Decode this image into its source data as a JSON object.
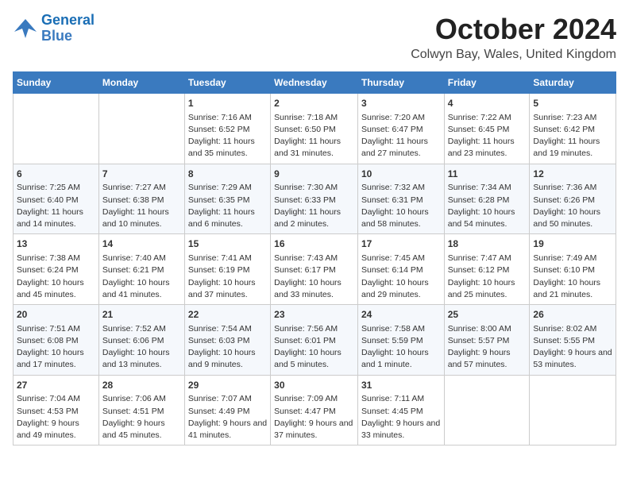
{
  "logo": {
    "line1": "General",
    "line2": "Blue"
  },
  "title": "October 2024",
  "subtitle": "Colwyn Bay, Wales, United Kingdom",
  "days_of_week": [
    "Sunday",
    "Monday",
    "Tuesday",
    "Wednesday",
    "Thursday",
    "Friday",
    "Saturday"
  ],
  "weeks": [
    [
      {
        "day": "",
        "info": ""
      },
      {
        "day": "",
        "info": ""
      },
      {
        "day": "1",
        "info": "Sunrise: 7:16 AM\nSunset: 6:52 PM\nDaylight: 11 hours and 35 minutes."
      },
      {
        "day": "2",
        "info": "Sunrise: 7:18 AM\nSunset: 6:50 PM\nDaylight: 11 hours and 31 minutes."
      },
      {
        "day": "3",
        "info": "Sunrise: 7:20 AM\nSunset: 6:47 PM\nDaylight: 11 hours and 27 minutes."
      },
      {
        "day": "4",
        "info": "Sunrise: 7:22 AM\nSunset: 6:45 PM\nDaylight: 11 hours and 23 minutes."
      },
      {
        "day": "5",
        "info": "Sunrise: 7:23 AM\nSunset: 6:42 PM\nDaylight: 11 hours and 19 minutes."
      }
    ],
    [
      {
        "day": "6",
        "info": "Sunrise: 7:25 AM\nSunset: 6:40 PM\nDaylight: 11 hours and 14 minutes."
      },
      {
        "day": "7",
        "info": "Sunrise: 7:27 AM\nSunset: 6:38 PM\nDaylight: 11 hours and 10 minutes."
      },
      {
        "day": "8",
        "info": "Sunrise: 7:29 AM\nSunset: 6:35 PM\nDaylight: 11 hours and 6 minutes."
      },
      {
        "day": "9",
        "info": "Sunrise: 7:30 AM\nSunset: 6:33 PM\nDaylight: 11 hours and 2 minutes."
      },
      {
        "day": "10",
        "info": "Sunrise: 7:32 AM\nSunset: 6:31 PM\nDaylight: 10 hours and 58 minutes."
      },
      {
        "day": "11",
        "info": "Sunrise: 7:34 AM\nSunset: 6:28 PM\nDaylight: 10 hours and 54 minutes."
      },
      {
        "day": "12",
        "info": "Sunrise: 7:36 AM\nSunset: 6:26 PM\nDaylight: 10 hours and 50 minutes."
      }
    ],
    [
      {
        "day": "13",
        "info": "Sunrise: 7:38 AM\nSunset: 6:24 PM\nDaylight: 10 hours and 45 minutes."
      },
      {
        "day": "14",
        "info": "Sunrise: 7:40 AM\nSunset: 6:21 PM\nDaylight: 10 hours and 41 minutes."
      },
      {
        "day": "15",
        "info": "Sunrise: 7:41 AM\nSunset: 6:19 PM\nDaylight: 10 hours and 37 minutes."
      },
      {
        "day": "16",
        "info": "Sunrise: 7:43 AM\nSunset: 6:17 PM\nDaylight: 10 hours and 33 minutes."
      },
      {
        "day": "17",
        "info": "Sunrise: 7:45 AM\nSunset: 6:14 PM\nDaylight: 10 hours and 29 minutes."
      },
      {
        "day": "18",
        "info": "Sunrise: 7:47 AM\nSunset: 6:12 PM\nDaylight: 10 hours and 25 minutes."
      },
      {
        "day": "19",
        "info": "Sunrise: 7:49 AM\nSunset: 6:10 PM\nDaylight: 10 hours and 21 minutes."
      }
    ],
    [
      {
        "day": "20",
        "info": "Sunrise: 7:51 AM\nSunset: 6:08 PM\nDaylight: 10 hours and 17 minutes."
      },
      {
        "day": "21",
        "info": "Sunrise: 7:52 AM\nSunset: 6:06 PM\nDaylight: 10 hours and 13 minutes."
      },
      {
        "day": "22",
        "info": "Sunrise: 7:54 AM\nSunset: 6:03 PM\nDaylight: 10 hours and 9 minutes."
      },
      {
        "day": "23",
        "info": "Sunrise: 7:56 AM\nSunset: 6:01 PM\nDaylight: 10 hours and 5 minutes."
      },
      {
        "day": "24",
        "info": "Sunrise: 7:58 AM\nSunset: 5:59 PM\nDaylight: 10 hours and 1 minute."
      },
      {
        "day": "25",
        "info": "Sunrise: 8:00 AM\nSunset: 5:57 PM\nDaylight: 9 hours and 57 minutes."
      },
      {
        "day": "26",
        "info": "Sunrise: 8:02 AM\nSunset: 5:55 PM\nDaylight: 9 hours and 53 minutes."
      }
    ],
    [
      {
        "day": "27",
        "info": "Sunrise: 7:04 AM\nSunset: 4:53 PM\nDaylight: 9 hours and 49 minutes."
      },
      {
        "day": "28",
        "info": "Sunrise: 7:06 AM\nSunset: 4:51 PM\nDaylight: 9 hours and 45 minutes."
      },
      {
        "day": "29",
        "info": "Sunrise: 7:07 AM\nSunset: 4:49 PM\nDaylight: 9 hours and 41 minutes."
      },
      {
        "day": "30",
        "info": "Sunrise: 7:09 AM\nSunset: 4:47 PM\nDaylight: 9 hours and 37 minutes."
      },
      {
        "day": "31",
        "info": "Sunrise: 7:11 AM\nSunset: 4:45 PM\nDaylight: 9 hours and 33 minutes."
      },
      {
        "day": "",
        "info": ""
      },
      {
        "day": "",
        "info": ""
      }
    ]
  ]
}
